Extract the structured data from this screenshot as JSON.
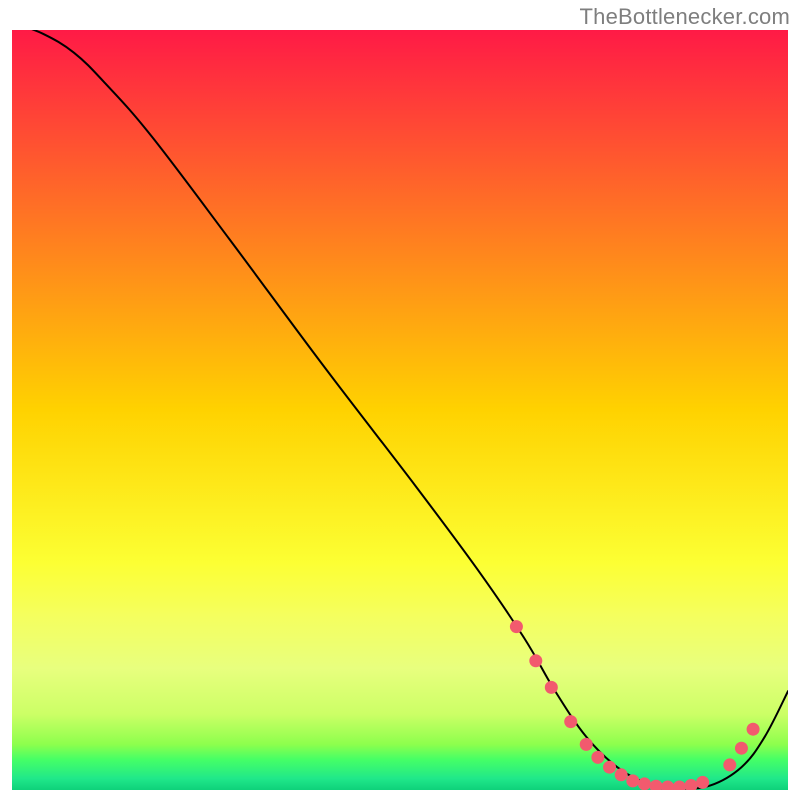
{
  "watermark": {
    "text": "TheBottlenecker.com"
  },
  "chart_data": {
    "type": "line",
    "title": "",
    "xlabel": "",
    "ylabel": "",
    "xlim": [
      0,
      100
    ],
    "ylim": [
      0,
      100
    ],
    "grid": false,
    "legend": false,
    "background_gradient": {
      "stops": [
        {
          "offset": 0.0,
          "color": "#ff1a46"
        },
        {
          "offset": 0.5,
          "color": "#ffd200"
        },
        {
          "offset": 0.7,
          "color": "#fcff33"
        },
        {
          "offset": 0.77,
          "color": "#f5ff5e"
        },
        {
          "offset": 0.84,
          "color": "#e8ff7e"
        },
        {
          "offset": 0.9,
          "color": "#ccff66"
        },
        {
          "offset": 0.94,
          "color": "#8dff4d"
        },
        {
          "offset": 0.96,
          "color": "#45ff66"
        },
        {
          "offset": 0.985,
          "color": "#20e88a"
        },
        {
          "offset": 1.0,
          "color": "#0ed17a"
        }
      ]
    },
    "series": [
      {
        "name": "curve",
        "x": [
          0,
          4,
          8,
          12,
          18,
          28,
          40,
          52,
          60,
          66,
          70,
          74,
          78,
          82,
          86,
          90,
          94,
          97,
          100
        ],
        "y": [
          101,
          99.5,
          97,
          93,
          86,
          72.5,
          56,
          40,
          29,
          20,
          13,
          7,
          3,
          0.8,
          0.2,
          0.6,
          3,
          7,
          13
        ]
      }
    ],
    "markers": {
      "color": "#f25a6e",
      "radius_px": 6.5,
      "points_xy": [
        [
          65,
          21.5
        ],
        [
          67.5,
          17
        ],
        [
          69.5,
          13.5
        ],
        [
          72,
          9
        ],
        [
          74,
          6
        ],
        [
          75.5,
          4.3
        ],
        [
          77,
          3
        ],
        [
          78.5,
          2
        ],
        [
          80,
          1.2
        ],
        [
          81.5,
          0.8
        ],
        [
          83,
          0.5
        ],
        [
          84.5,
          0.4
        ],
        [
          86,
          0.4
        ],
        [
          87.5,
          0.6
        ],
        [
          89,
          1.0
        ],
        [
          92.5,
          3.3
        ],
        [
          94,
          5.5
        ],
        [
          95.5,
          8
        ]
      ]
    }
  }
}
